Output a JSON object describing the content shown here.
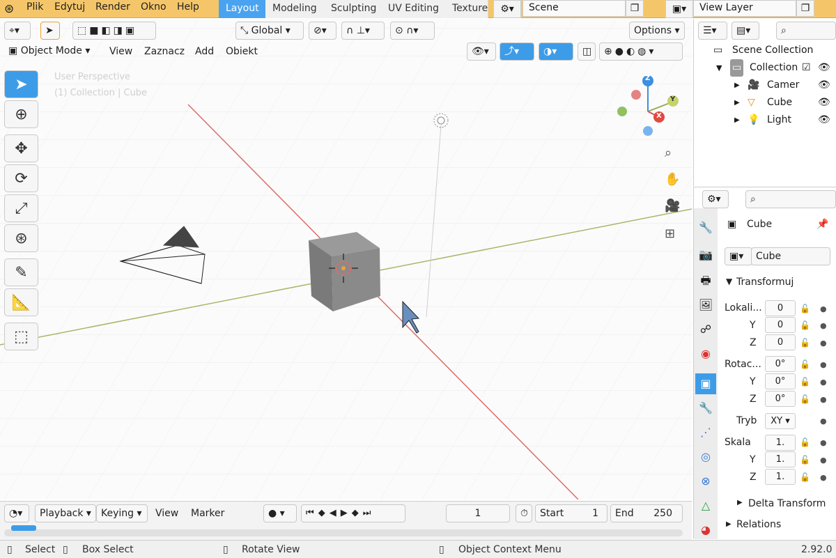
{
  "menu": {
    "items": [
      "Plik",
      "Edytuj",
      "Render",
      "Okno",
      "Help"
    ]
  },
  "workspaces": {
    "tabs": [
      "Layout",
      "Modeling",
      "Sculpting",
      "UV Editing",
      "Texture"
    ],
    "active": "Layout"
  },
  "scene": {
    "name": "Scene",
    "view_layer": "View Layer"
  },
  "viewport_header": {
    "transform_orientation": "Global",
    "options_label": "Options",
    "mode": "Object Mode",
    "menus": [
      "View",
      "Zaznacz",
      "Add",
      "Obiekt"
    ]
  },
  "viewport": {
    "perspective_label": "User Perspective",
    "context_label": "(1) Collection | Cube"
  },
  "gizmo": {
    "z": "Z",
    "y": "Y",
    "x": "X"
  },
  "outliner": {
    "root": "Scene Collection",
    "collection": "Collection",
    "items": [
      "Camer",
      "Cube",
      "Light"
    ]
  },
  "properties": {
    "object_name": "Cube",
    "mesh_name": "Cube",
    "section_transform": "Transformuj",
    "location_label": "Lokali...",
    "rotation_label": "Rotac...",
    "mode_label": "Tryb",
    "mode_value": "XY",
    "scale_label": "Skala",
    "axis_y": "Y",
    "axis_z": "Z",
    "location": [
      "0",
      "0",
      "0"
    ],
    "rotation": [
      "0°",
      "0°",
      "0°"
    ],
    "scale": [
      "1.",
      "1.",
      "1."
    ],
    "delta_transform": "Delta Transform",
    "relations": "Relations"
  },
  "timeline": {
    "menus": [
      "Playback",
      "Keying",
      "View",
      "Marker"
    ],
    "current_frame": "1",
    "start_label": "Start",
    "start_value": "1",
    "end_label": "End",
    "end_value": "250"
  },
  "statusbar": {
    "select": "Select",
    "box_select": "Box Select",
    "rotate_view": "Rotate View",
    "context_menu": "Object Context Menu",
    "version": "2.92.0"
  },
  "colors": {
    "topbar": "#f5c669",
    "accent": "#3d9ce8",
    "x_axis": "#d9534f",
    "y_axis": "#9aab4f",
    "z_axis": "#3d8fe0"
  }
}
